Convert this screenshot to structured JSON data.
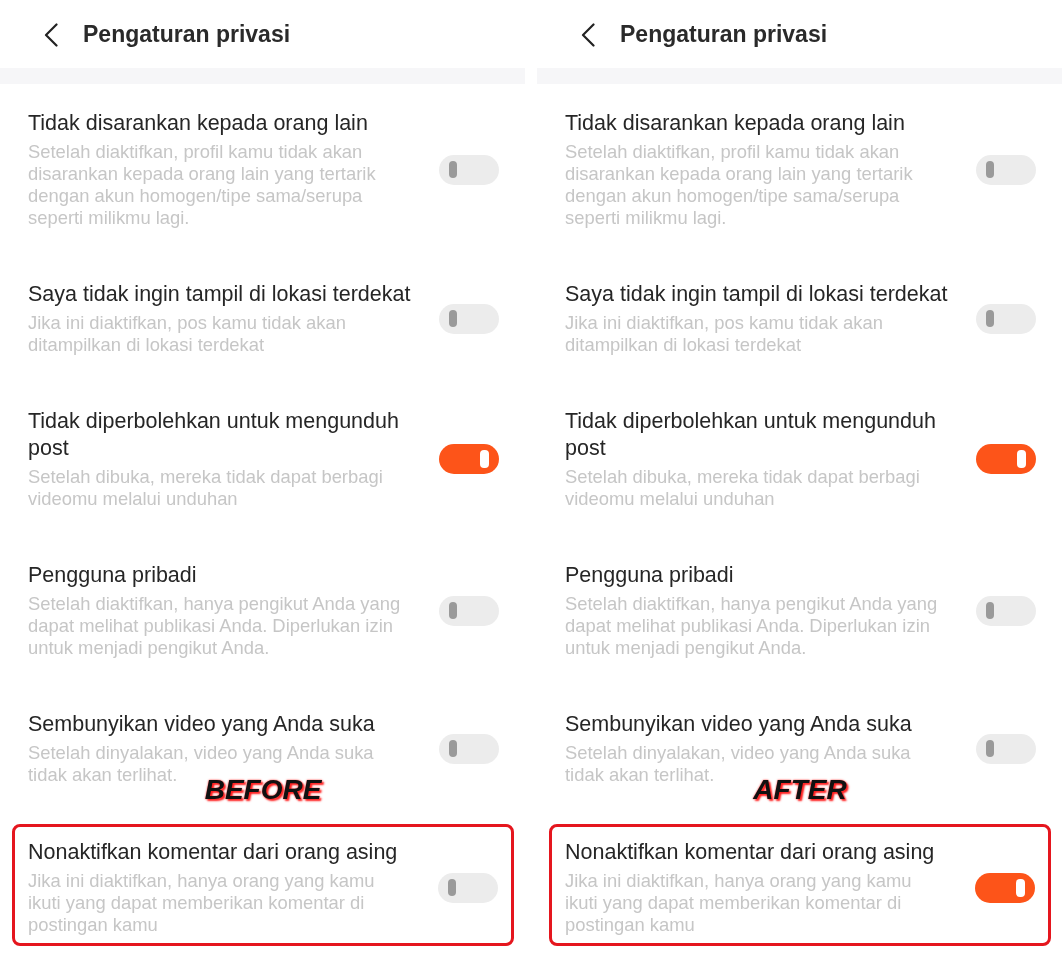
{
  "panels": [
    {
      "header": {
        "title": "Pengaturan privasi"
      },
      "caption": "BEFORE",
      "settings": [
        {
          "title": "Tidak disarankan kepada orang lain",
          "description": "Setelah diaktifkan, profil kamu tidak akan disarankan kepada orang lain yang tertarik dengan akun homogen/tipe sama/serupa seperti milikmu lagi.",
          "on": false,
          "highlighted": false
        },
        {
          "title": "Saya tidak ingin tampil di lokasi terdekat",
          "description": "Jika ini diaktifkan, pos kamu tidak akan ditampilkan di lokasi terdekat",
          "on": false,
          "highlighted": false
        },
        {
          "title": "Tidak diperbolehkan untuk mengunduh post",
          "description": "Setelah dibuka, mereka tidak dapat berbagi videomu melalui unduhan",
          "on": true,
          "highlighted": false
        },
        {
          "title": "Pengguna pribadi",
          "description": "Setelah diaktifkan, hanya pengikut Anda yang dapat melihat publikasi Anda. Diperlukan izin untuk menjadi pengikut Anda.",
          "on": false,
          "highlighted": false
        },
        {
          "title": "Sembunyikan video yang Anda suka",
          "description": "Setelah dinyalakan, video yang Anda suka tidak akan terlihat.",
          "on": false,
          "highlighted": false
        },
        {
          "title": "Nonaktifkan komentar dari orang asing",
          "description": "Jika ini diaktifkan, hanya orang yang kamu ikuti yang dapat memberikan komentar di postingan kamu",
          "on": false,
          "highlighted": true
        }
      ]
    },
    {
      "header": {
        "title": "Pengaturan privasi"
      },
      "caption": "AFTER",
      "settings": [
        {
          "title": "Tidak disarankan kepada orang lain",
          "description": "Setelah diaktifkan, profil kamu tidak akan disarankan kepada orang lain yang tertarik dengan akun homogen/tipe sama/serupa seperti milikmu lagi.",
          "on": false,
          "highlighted": false
        },
        {
          "title": "Saya tidak ingin tampil di lokasi terdekat",
          "description": "Jika ini diaktifkan, pos kamu tidak akan ditampilkan di lokasi terdekat",
          "on": false,
          "highlighted": false
        },
        {
          "title": "Tidak diperbolehkan untuk mengunduh post",
          "description": "Setelah dibuka, mereka tidak dapat berbagi videomu melalui unduhan",
          "on": true,
          "highlighted": false
        },
        {
          "title": "Pengguna pribadi",
          "description": "Setelah diaktifkan, hanya pengikut Anda yang dapat melihat publikasi Anda. Diperlukan izin untuk menjadi pengikut Anda.",
          "on": false,
          "highlighted": false
        },
        {
          "title": "Sembunyikan video yang Anda suka",
          "description": "Setelah dinyalakan, video yang Anda suka tidak akan terlihat.",
          "on": false,
          "highlighted": false
        },
        {
          "title": "Nonaktifkan komentar dari orang asing",
          "description": "Jika ini diaktifkan, hanya orang yang kamu ikuti yang dapat memberikan komentar di postingan kamu",
          "on": true,
          "highlighted": true
        }
      ]
    }
  ]
}
